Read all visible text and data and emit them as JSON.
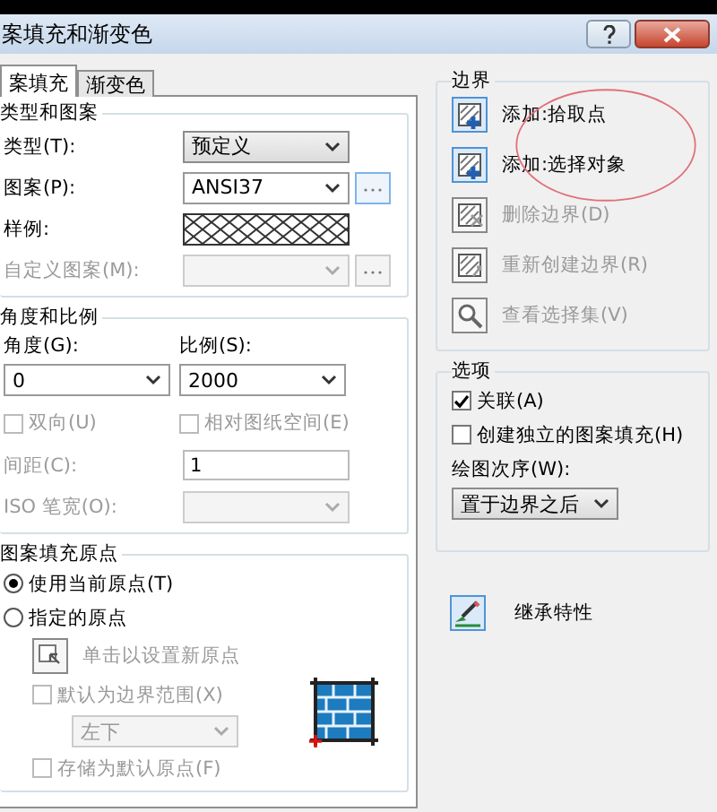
{
  "window": {
    "title": "案填充和渐变色"
  },
  "tabs": [
    {
      "label": "案填充",
      "selected": true
    },
    {
      "label": "渐变色",
      "selected": false
    }
  ],
  "type_and_pattern": {
    "title": "类型和图案",
    "rows": [
      {
        "label": "类型(T):",
        "kind": "combo",
        "value": "预定义",
        "disabled": false
      },
      {
        "label": "图案(P):",
        "kind": "combo_browse",
        "value": "ANSI37",
        "disabled": false
      },
      {
        "label": "样例:",
        "kind": "swatch",
        "disabled": false
      },
      {
        "label": "自定义图案(M):",
        "kind": "combo_browse",
        "disabled": true
      }
    ]
  },
  "angle_and_scale": {
    "title": "角度和比例",
    "angle": {
      "label": "角度(G):",
      "value": "0"
    },
    "scale": {
      "label": "比例(S):",
      "value": "2000"
    },
    "checkboxes": [
      {
        "label": "双向(U)",
        "checked": false,
        "disabled": true
      },
      {
        "label": "相对图纸空间(E)",
        "checked": false,
        "disabled": true
      }
    ],
    "spacing": {
      "label": "间距(C):",
      "value": "1",
      "disabled": true
    },
    "iso_pen_width": {
      "label": "ISO 笔宽(O):",
      "disabled": true
    }
  },
  "origin": {
    "title": "图案填充原点",
    "radios": [
      {
        "label": "使用当前原点(T)",
        "selected": true
      },
      {
        "label": "指定的原点",
        "selected": false
      }
    ],
    "set_origin": {
      "label": "单击以设置新原点",
      "disabled": true
    },
    "default_extent": {
      "label": "默认为边界范围(X)",
      "checked": false,
      "disabled": true
    },
    "position": {
      "value": "左下",
      "disabled": true
    },
    "store_default": {
      "label": "存储为默认原点(F)",
      "checked": false,
      "disabled": true
    }
  },
  "boundaries": {
    "title": "边界",
    "buttons": [
      {
        "label": "添加:拾取点",
        "disabled": false
      },
      {
        "label": "添加:选择对象",
        "disabled": false
      },
      {
        "label": "删除边界(D)",
        "disabled": true
      },
      {
        "label": "重新创建边界(R)",
        "disabled": true
      },
      {
        "label": "查看选择集(V)",
        "disabled": true
      }
    ]
  },
  "options": {
    "title": "选项",
    "checkboxes": [
      {
        "label": "关联(A)",
        "checked": true
      },
      {
        "label": "创建独立的图案填充(H)",
        "checked": false
      }
    ],
    "draw_order": {
      "label": "绘图次序(W):",
      "value": "置于边界之后"
    }
  },
  "inherit": {
    "label": "继承特性"
  }
}
